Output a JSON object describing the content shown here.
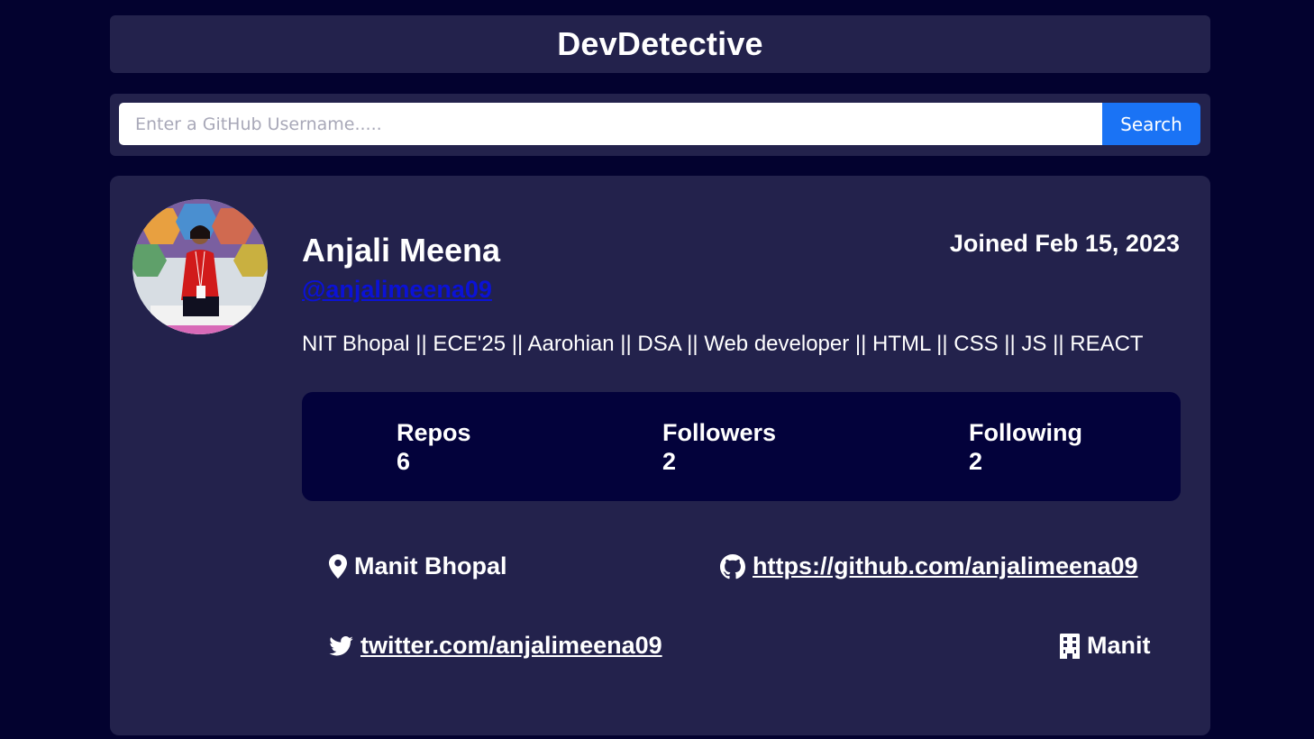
{
  "app": {
    "title": "DevDetective"
  },
  "search": {
    "placeholder": "Enter a GitHub Username.....",
    "value": "",
    "button_label": "Search",
    "button_color": "#1a73f5"
  },
  "profile": {
    "name": "Anjali Meena",
    "username": "@anjalimeena09",
    "joined": "Joined Feb 15, 2023",
    "bio": "NIT Bhopal || ECE'25 || Aarohian || DSA || Web developer || HTML || CSS || JS || REACT",
    "avatar_alt": "avatar"
  },
  "stats": {
    "repos_label": "Repos",
    "repos_value": "6",
    "followers_label": "Followers",
    "followers_value": "2",
    "following_label": "Following",
    "following_value": "2"
  },
  "info": {
    "location": "Manit Bhopal",
    "location_icon": "map-pin-icon",
    "blog": "https://github.com/anjalimeena09",
    "blog_icon": "github-icon",
    "twitter": "twitter.com/anjalimeena09",
    "twitter_icon": "twitter-icon",
    "company": "Manit",
    "company_icon": "building-icon"
  },
  "colors": {
    "background": "#03022f",
    "panel": "#23224c",
    "stats_panel": "#03023b",
    "username_link": "#0b12d6",
    "accent": "#1a73f5"
  }
}
